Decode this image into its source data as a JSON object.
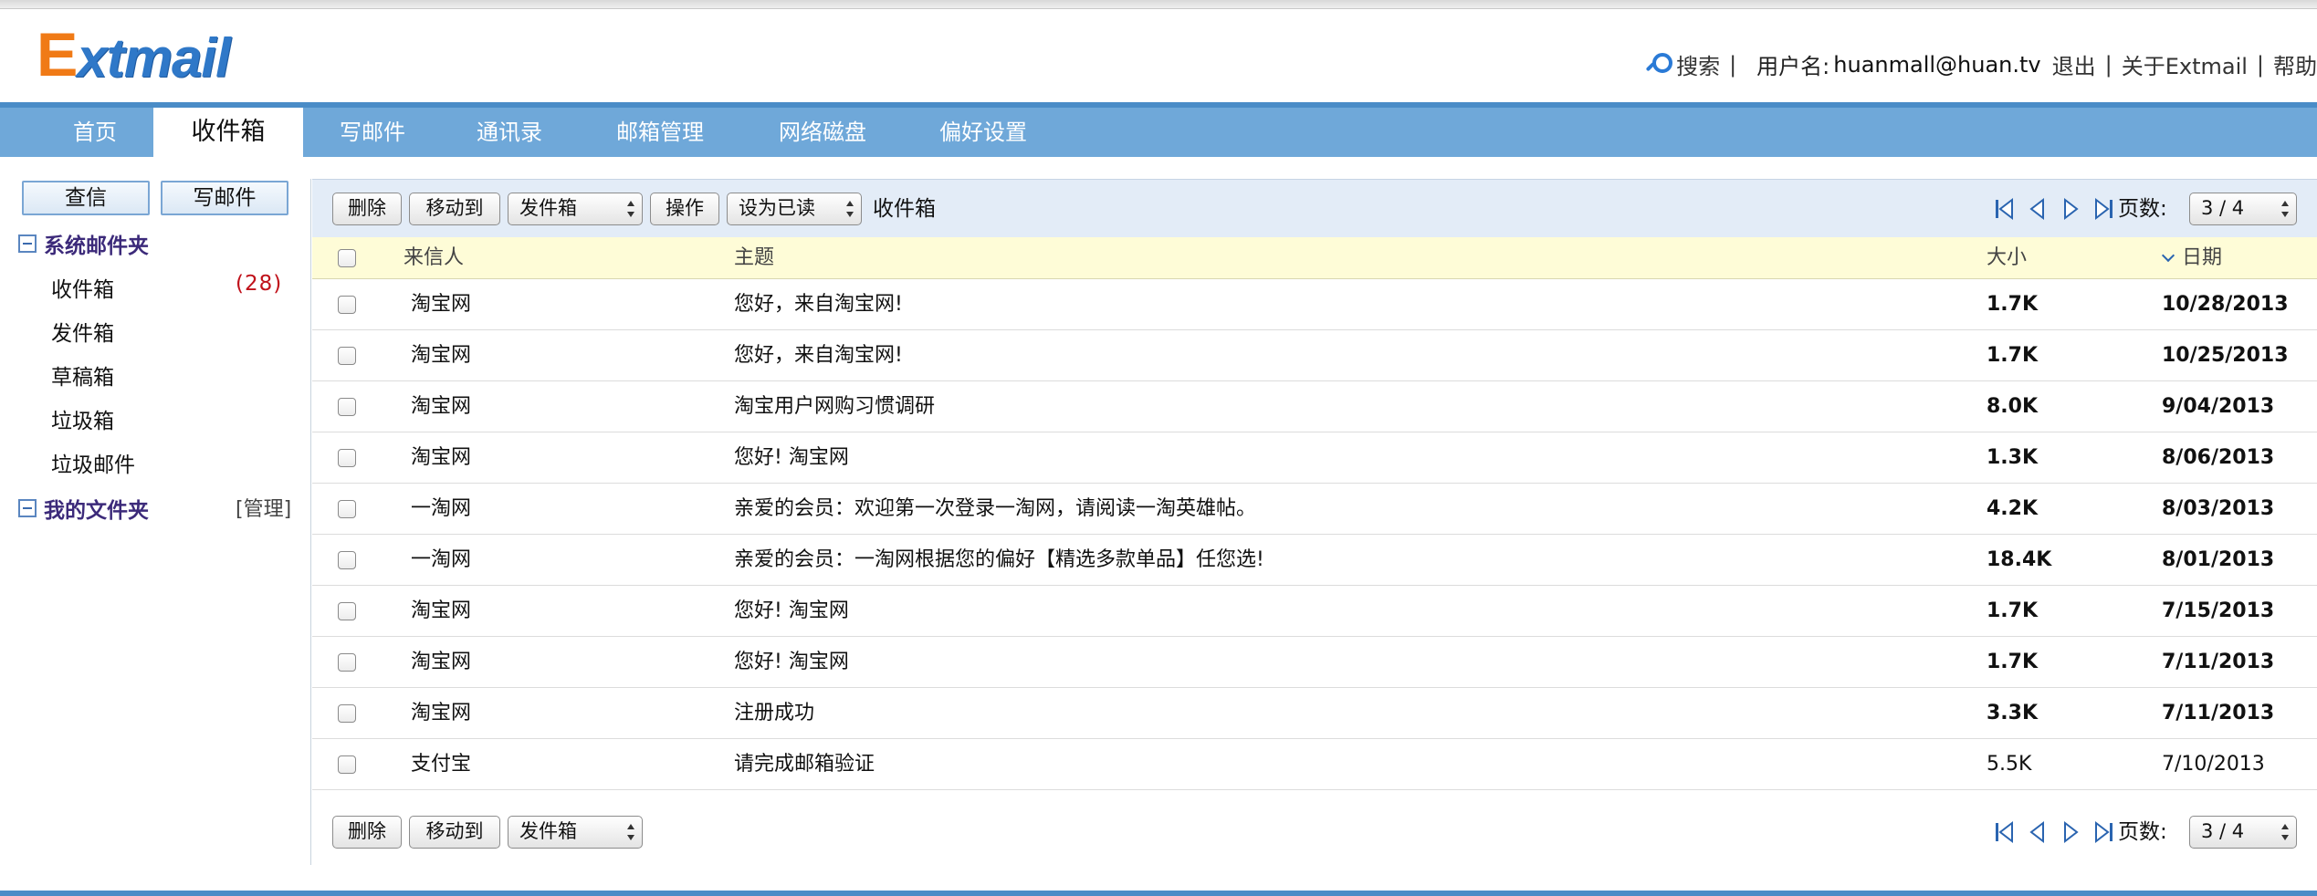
{
  "header": {
    "logo_e": "E",
    "logo_rest": "xtmail",
    "search": "搜索",
    "sep": "|",
    "user_label": "用户名:",
    "user_value": "huanmall@huan.tv",
    "logout": "退出",
    "about": "关于Extmail",
    "help": "帮助"
  },
  "nav": {
    "items": [
      "首页",
      "收件箱",
      "写邮件",
      "通讯录",
      "邮箱管理",
      "网络磁盘",
      "偏好设置"
    ],
    "active": "收件箱"
  },
  "sidebar": {
    "check_mail": "查信",
    "compose": "写邮件",
    "system_folders": "系统邮件夹",
    "folders": [
      {
        "name": "收件箱",
        "unread": "(28)"
      },
      {
        "name": "发件箱"
      },
      {
        "name": "草稿箱"
      },
      {
        "name": "垃圾箱"
      },
      {
        "name": "垃圾邮件"
      }
    ],
    "my_folders": "我的文件夹",
    "manage": "[管理]"
  },
  "toolbar": {
    "delete": "删除",
    "move_to": "移动到",
    "folder_select": "发件箱",
    "action": "操作",
    "mark_select": "设为已读",
    "current_folder": "收件箱",
    "page_label": "页数:",
    "page_value": "3 / 4"
  },
  "table": {
    "headers": {
      "from": "来信人",
      "subject": "主题",
      "size": "大小",
      "date": "日期"
    },
    "rows": [
      {
        "from": "淘宝网",
        "subject": "您好，来自淘宝网!",
        "size": "1.7K",
        "date": "10/28/2013",
        "bold": true
      },
      {
        "from": "淘宝网",
        "subject": "您好，来自淘宝网!",
        "size": "1.7K",
        "date": "10/25/2013",
        "bold": true
      },
      {
        "from": "淘宝网",
        "subject": "淘宝用户网购习惯调研",
        "size": "8.0K",
        "date": "9/04/2013",
        "bold": true
      },
      {
        "from": "淘宝网",
        "subject": "您好! 淘宝网",
        "size": "1.3K",
        "date": "8/06/2013",
        "bold": true
      },
      {
        "from": "一淘网",
        "subject": "亲爱的会员：欢迎第一次登录一淘网，请阅读一淘英雄帖。",
        "size": "4.2K",
        "date": "8/03/2013",
        "bold": true
      },
      {
        "from": "一淘网",
        "subject": "亲爱的会员：一淘网根据您的偏好【精选多款单品】任您选!",
        "size": "18.4K",
        "date": "8/01/2013",
        "bold": true
      },
      {
        "from": "淘宝网",
        "subject": "您好! 淘宝网",
        "size": "1.7K",
        "date": "7/15/2013",
        "bold": true
      },
      {
        "from": "淘宝网",
        "subject": "您好! 淘宝网",
        "size": "1.7K",
        "date": "7/11/2013",
        "bold": true
      },
      {
        "from": "淘宝网",
        "subject": "注册成功",
        "size": "3.3K",
        "date": "7/11/2013",
        "bold": true
      },
      {
        "from": "支付宝",
        "subject": "请完成邮箱验证",
        "size": "5.5K",
        "date": "7/10/2013",
        "bold": false
      }
    ]
  },
  "colors": {
    "nav_bg": "#6fa8d9",
    "unread_red": "#c0111a",
    "logo_orange": "#f07a16",
    "logo_blue": "#2f78c8"
  }
}
